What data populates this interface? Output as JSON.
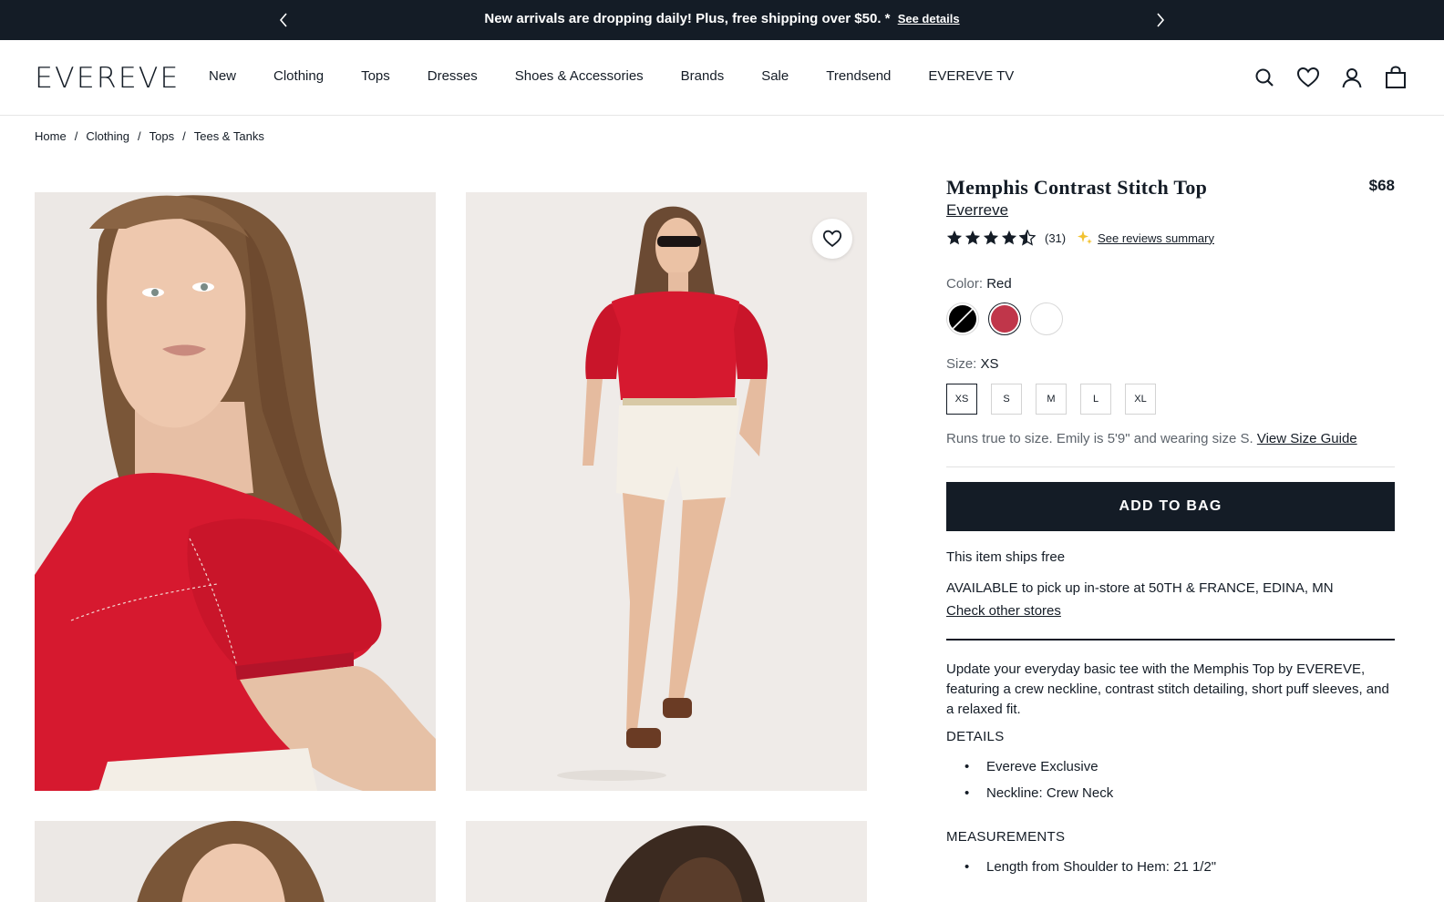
{
  "announcement": {
    "message": "New arrivals are dropping daily! Plus, free shipping over $50. *",
    "link": "See details"
  },
  "header": {
    "logo": "EVEREVE",
    "nav": [
      "New",
      "Clothing",
      "Tops",
      "Dresses",
      "Shoes & Accessories",
      "Brands",
      "Sale",
      "Trendsend",
      "EVEREVE TV"
    ],
    "icons": [
      "search-icon",
      "heart-icon",
      "account-icon",
      "bag-icon"
    ]
  },
  "breadcrumb": [
    "Home",
    "Clothing",
    "Tops",
    "Tees & Tanks"
  ],
  "product": {
    "title": "Memphis Contrast Stitch Top",
    "price": "$68",
    "brand": "Everreve",
    "rating_value": 4.5,
    "review_count": "(31)",
    "reviews_summary_link": "See reviews summary",
    "color_label": "Color:",
    "color_value": "Red",
    "swatches": [
      {
        "name": "Black",
        "color": "#000000"
      },
      {
        "name": "Red",
        "color": "#c0364a"
      },
      {
        "name": "White",
        "color": "#ffffff"
      }
    ],
    "size_label": "Size:",
    "size_value": "XS",
    "sizes": [
      "XS",
      "S",
      "M",
      "L",
      "XL"
    ],
    "fit_note": "Runs true to size. Emily is 5'9\" and wearing size S.",
    "size_guide_link": "View Size Guide",
    "add_to_bag": "ADD TO BAG",
    "ships_free": "This item ships free",
    "pickup": "AVAILABLE to pick up in-store at 50TH & FRANCE, EDINA, MN",
    "check_stores": "Check other stores",
    "description": "Update your everyday basic tee with the Memphis Top by EVEREVE, featuring a crew neckline, contrast stitch detailing, short puff sleeves, and a relaxed fit.",
    "details_heading": "DETAILS",
    "details": [
      "Evereve Exclusive",
      "Neckline: Crew Neck"
    ],
    "measurements_heading": "MEASUREMENTS",
    "measurements": [
      "Length from Shoulder to Hem: 21 1/2\""
    ]
  },
  "colors": {
    "dark": "#141c26",
    "product_red": "#d6192f",
    "photo_bg": "#efebe8",
    "star_yellow": "#f2c230"
  }
}
